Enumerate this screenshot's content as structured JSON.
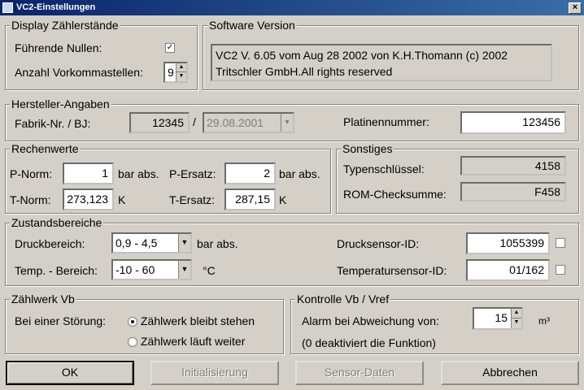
{
  "window": {
    "title": "VC2-Einstellungen",
    "close_glyph": "×"
  },
  "display": {
    "legend": "Display Zählerstände",
    "fuehrende_nullen_label": "Führende Nullen:",
    "fuehrende_nullen_checked": true,
    "anzahl_label": "Anzahl Vorkommastellen:",
    "anzahl_value": "9"
  },
  "software": {
    "legend": "Software Version",
    "line1": "VC2 V. 6.05 vom Aug 28 2002 von K.H.Thomann (c) 2002",
    "line2": "Tritschler GmbH.All rights reserved"
  },
  "hersteller": {
    "legend": "Hersteller-Angaben",
    "fabrik_label": "Fabrik-Nr. / BJ:",
    "fabrik_nr": "12345",
    "separator": "/",
    "baujahr": "29.08.2001",
    "platinen_label": "Platinennummer:",
    "platinen_nr": "123456"
  },
  "rechenwerte": {
    "legend": "Rechenwerte",
    "pnorm_label": "P-Norm:",
    "pnorm_value": "1",
    "pnorm_unit": "bar abs.",
    "persatz_label": "P-Ersatz:",
    "persatz_value": "2",
    "persatz_unit": "bar abs.",
    "tnorm_label": "T-Norm:",
    "tnorm_value": "273,123",
    "tnorm_unit": "K",
    "tersatz_label": "T-Ersatz:",
    "tersatz_value": "287,15",
    "tersatz_unit": "K"
  },
  "sonstiges": {
    "legend": "Sonstiges",
    "typen_label": "Typenschlüssel:",
    "typen_value": "4158",
    "rom_label": "ROM-Checksumme:",
    "rom_value": "F458"
  },
  "zustand": {
    "legend": "Zustandsbereiche",
    "druck_label": "Druckbereich:",
    "druck_value": "0,9  -  4,5",
    "druck_unit": "bar abs.",
    "temp_label": "Temp. - Bereich:",
    "temp_value": "-10 -  60",
    "temp_unit": "°C",
    "drucksensor_label": "Drucksensor-ID:",
    "drucksensor_value": "1055399",
    "tempsensor_label": "Temperatursensor-ID:",
    "tempsensor_value": "01/162"
  },
  "zaehlwerk": {
    "legend": "Zählwerk Vb",
    "stoerung_label": "Bei einer Störung:",
    "option1": "Zählwerk bleibt stehen",
    "option2": "Zählwerk läuft weiter",
    "selected": 1
  },
  "kontrolle": {
    "legend": "Kontrolle Vb / Vref",
    "alarm_label": "Alarm bei Abweichung von:",
    "alarm_value": "15",
    "alarm_unit": "m³",
    "hint": "(0 deaktiviert die Funktion)"
  },
  "buttons": {
    "ok": "OK",
    "init": "Initialisierung",
    "sensor": "Sensor-Daten",
    "cancel": "Abbrechen"
  }
}
